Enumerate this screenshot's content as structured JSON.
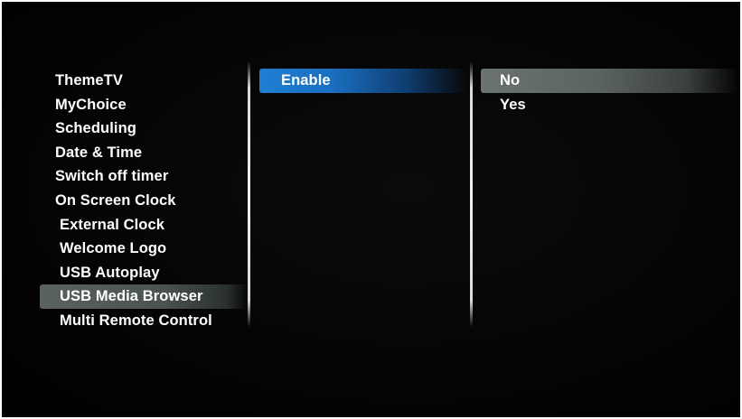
{
  "menu": {
    "items": [
      {
        "label": "ThemeTV"
      },
      {
        "label": "MyChoice"
      },
      {
        "label": "Scheduling"
      },
      {
        "label": "Date & Time"
      },
      {
        "label": "Switch off timer"
      },
      {
        "label": "On Screen Clock"
      },
      {
        "label": "External Clock"
      },
      {
        "label": "Welcome Logo"
      },
      {
        "label": "USB Autoplay"
      },
      {
        "label": "USB Media Browser"
      },
      {
        "label": "Multi Remote Control"
      }
    ],
    "selected_index": 9
  },
  "submenu": {
    "items": [
      {
        "label": "Enable"
      }
    ],
    "focused_index": 0
  },
  "options": {
    "items": [
      {
        "label": "No"
      },
      {
        "label": "Yes"
      }
    ],
    "selected_index": 0
  },
  "colors": {
    "background": "#000000",
    "text": "#ffffff",
    "focus_highlight": "#1e7fd2",
    "selection_highlight": "#5a6360"
  }
}
